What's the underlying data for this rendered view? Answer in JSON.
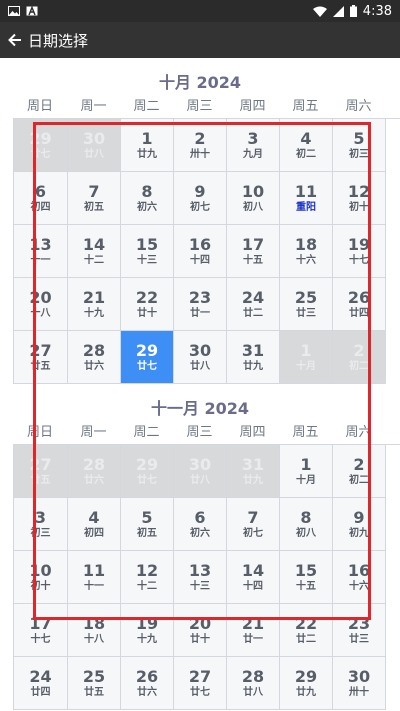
{
  "status_bar": {
    "time": "4:38"
  },
  "app_bar": {
    "title": "日期选择"
  },
  "weekdays": [
    "周日",
    "周一",
    "周二",
    "周三",
    "周四",
    "周五",
    "周六"
  ],
  "months": [
    {
      "title": "十月 2024",
      "weeks": [
        [
          {
            "d": "29",
            "l": "廿七",
            "t": "other"
          },
          {
            "d": "30",
            "l": "廿八",
            "t": "other"
          },
          {
            "d": "1",
            "l": "廿九"
          },
          {
            "d": "2",
            "l": "卅十"
          },
          {
            "d": "3",
            "l": "九月"
          },
          {
            "d": "4",
            "l": "初二"
          },
          {
            "d": "5",
            "l": "初三"
          }
        ],
        [
          {
            "d": "6",
            "l": "初四"
          },
          {
            "d": "7",
            "l": "初五"
          },
          {
            "d": "8",
            "l": "初六"
          },
          {
            "d": "9",
            "l": "初七"
          },
          {
            "d": "10",
            "l": "初八"
          },
          {
            "d": "11",
            "l": "重阳",
            "t": "festival"
          },
          {
            "d": "12",
            "l": "初十"
          }
        ],
        [
          {
            "d": "13",
            "l": "十一"
          },
          {
            "d": "14",
            "l": "十二"
          },
          {
            "d": "15",
            "l": "十三"
          },
          {
            "d": "16",
            "l": "十四"
          },
          {
            "d": "17",
            "l": "十五"
          },
          {
            "d": "18",
            "l": "十六"
          },
          {
            "d": "19",
            "l": "十七"
          }
        ],
        [
          {
            "d": "20",
            "l": "十八"
          },
          {
            "d": "21",
            "l": "十九"
          },
          {
            "d": "22",
            "l": "廿十"
          },
          {
            "d": "23",
            "l": "廿一"
          },
          {
            "d": "24",
            "l": "廿二"
          },
          {
            "d": "25",
            "l": "廿三"
          },
          {
            "d": "26",
            "l": "廿四"
          }
        ],
        [
          {
            "d": "27",
            "l": "廿五"
          },
          {
            "d": "28",
            "l": "廿六"
          },
          {
            "d": "29",
            "l": "廿七",
            "t": "selected"
          },
          {
            "d": "30",
            "l": "廿八"
          },
          {
            "d": "31",
            "l": "廿九"
          },
          {
            "d": "1",
            "l": "十月",
            "t": "other"
          },
          {
            "d": "2",
            "l": "初二",
            "t": "other"
          }
        ]
      ]
    },
    {
      "title": "十一月 2024",
      "weeks": [
        [
          {
            "d": "27",
            "l": "廿五",
            "t": "other"
          },
          {
            "d": "28",
            "l": "廿六",
            "t": "other"
          },
          {
            "d": "29",
            "l": "廿七",
            "t": "other"
          },
          {
            "d": "30",
            "l": "廿八",
            "t": "other"
          },
          {
            "d": "31",
            "l": "廿九",
            "t": "other"
          },
          {
            "d": "1",
            "l": "十月"
          },
          {
            "d": "2",
            "l": "初二"
          }
        ],
        [
          {
            "d": "3",
            "l": "初三"
          },
          {
            "d": "4",
            "l": "初四"
          },
          {
            "d": "5",
            "l": "初五"
          },
          {
            "d": "6",
            "l": "初六"
          },
          {
            "d": "7",
            "l": "初七"
          },
          {
            "d": "8",
            "l": "初八"
          },
          {
            "d": "9",
            "l": "初九"
          }
        ],
        [
          {
            "d": "10",
            "l": "初十"
          },
          {
            "d": "11",
            "l": "十一"
          },
          {
            "d": "12",
            "l": "十二"
          },
          {
            "d": "13",
            "l": "十三"
          },
          {
            "d": "14",
            "l": "十四"
          },
          {
            "d": "15",
            "l": "十五"
          },
          {
            "d": "16",
            "l": "十六"
          }
        ],
        [
          {
            "d": "17",
            "l": "十七"
          },
          {
            "d": "18",
            "l": "十八"
          },
          {
            "d": "19",
            "l": "十九"
          },
          {
            "d": "20",
            "l": "廿十"
          },
          {
            "d": "21",
            "l": "廿一"
          },
          {
            "d": "22",
            "l": "廿二"
          },
          {
            "d": "23",
            "l": "廿三"
          }
        ],
        [
          {
            "d": "24",
            "l": "廿四"
          },
          {
            "d": "25",
            "l": "廿五"
          },
          {
            "d": "26",
            "l": "廿六"
          },
          {
            "d": "27",
            "l": "廿七"
          },
          {
            "d": "28",
            "l": "廿八"
          },
          {
            "d": "29",
            "l": "廿九"
          },
          {
            "d": "30",
            "l": "卅十"
          }
        ]
      ]
    }
  ],
  "colors": {
    "selected": "#3d8ff5",
    "festival": "#1a32c8",
    "highlight_box": "#e0262a"
  }
}
